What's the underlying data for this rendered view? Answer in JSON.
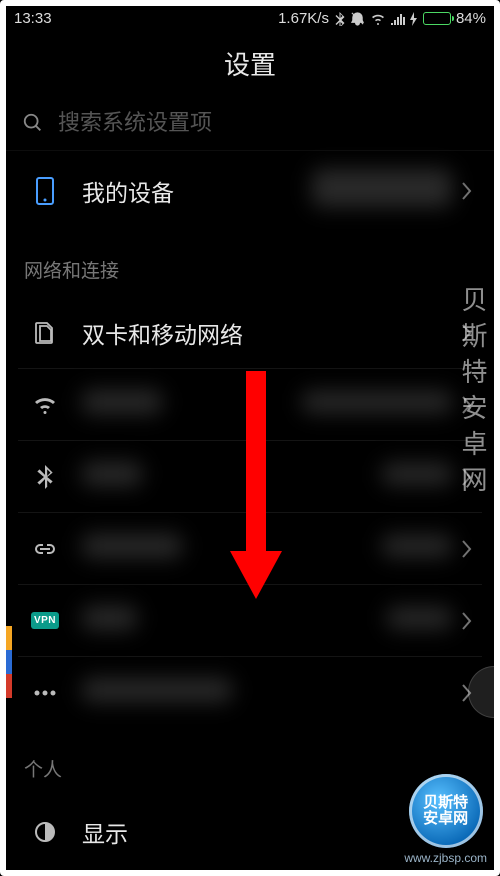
{
  "status": {
    "time": "13:33",
    "speed": "1.67K/s",
    "battery": "84%"
  },
  "title": "设置",
  "search": {
    "placeholder": "搜索系统设置项"
  },
  "device": {
    "label": "我的设备",
    "detail": ""
  },
  "network_section": "网络和连接",
  "rows": {
    "sim": "双卡和移动网络",
    "wlan": "WLAN",
    "bt": "蓝牙",
    "hotspot": "个人热点",
    "vpn": "VPN",
    "vpn_icon": "VPN",
    "more": "更多连接方式"
  },
  "personal_section": "个人",
  "display": "显示",
  "watermark": {
    "vertical": "贝斯特安卓网",
    "logo_top": "贝斯特",
    "logo_bottom": "安卓网",
    "url": "www.zjbsp.com"
  }
}
